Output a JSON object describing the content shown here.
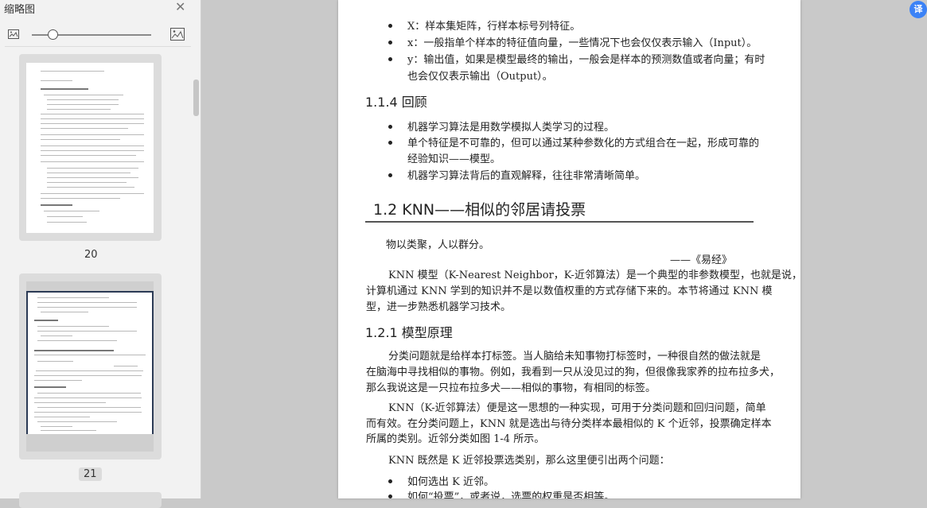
{
  "sidebar": {
    "title": "缩略图",
    "pages": [
      {
        "label": "20"
      },
      {
        "label": "21"
      }
    ]
  },
  "extension": {
    "label": "译"
  },
  "document": {
    "bullets_top": [
      "X：样本集矩阵，行样本标号列特征。",
      "x：一般指单个样本的特征值向量，一些情况下也会仅仅表示输入（Input）。",
      "y：输出值，如果是模型最终的输出，一般会是样本的预测数值或者向量；有时",
      "也会仅仅表示输出（Output）。"
    ],
    "sec_114": "1.1.4   回顾",
    "bullets_review": [
      "机器学习算法是用数学模拟人类学习的过程。",
      "单个特征是不可靠的，但可以通过某种参数化的方式组合在一起，形成可靠的",
      "经验知识——模型。",
      "机器学习算法背后的直观解释，往往非常清晰简单。"
    ],
    "chapter_12": "1.2   KNN——相似的邻居请投票",
    "quote": "物以类聚，人以群分。",
    "quote_source": "——《易经》",
    "para1": [
      "KNN 模型（K-Nearest Neighbor，K-近邻算法）是一个典型的非参数模型，也就是说，",
      "计算机通过 KNN 学到的知识并不是以数值权重的方式存储下来的。本节将通过 KNN 模",
      "型，进一步熟悉机器学习技术。"
    ],
    "sec_121": "1.2.1   模型原理",
    "para2": [
      "分类问题就是给样本打标签。当人脑给未知事物打标签时，一种很自然的做法就是",
      "在脑海中寻找相似的事物。例如，我看到一只从没见过的狗，但很像我家养的拉布拉多犬，",
      "那么我说这是一只拉布拉多犬——相似的事物，有相同的标签。"
    ],
    "para3": [
      "KNN（K-近邻算法）便是这一思想的一种实现，可用于分类问题和回归问题，简单",
      "而有效。在分类问题上，KNN 就是选出与待分类样本最相似的 K 个近邻，投票确定样本",
      "所属的类别。近邻分类如图 1-4 所示。"
    ],
    "para4": "KNN 既然是 K 近邻投票选类别，那么这里便引出两个问题：",
    "bullets_q": [
      "如何选出 K 近邻。",
      "如何“投票”，或者说，选票的权重是否相等。"
    ]
  }
}
